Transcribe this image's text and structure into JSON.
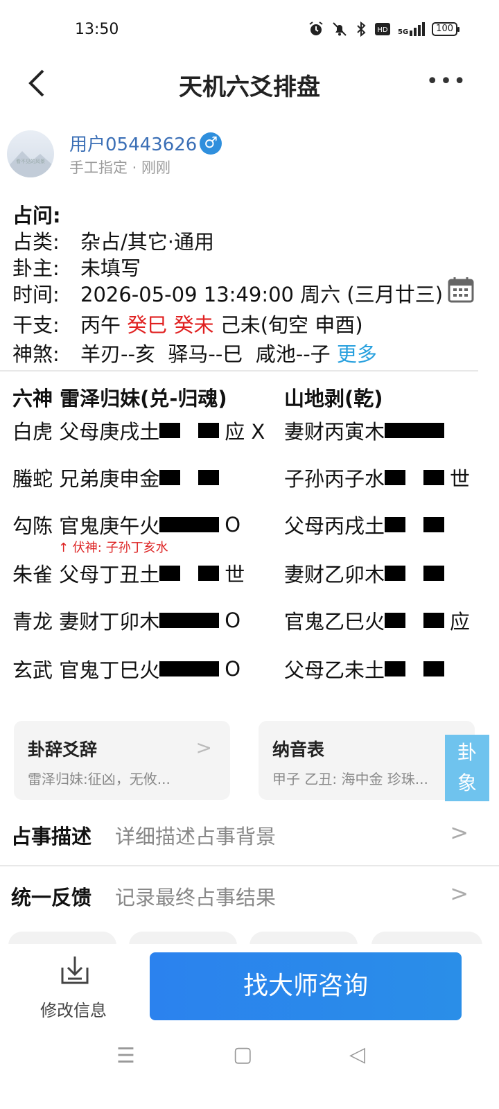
{
  "status": {
    "time": "13:50",
    "network": "5G",
    "battery": "100"
  },
  "header": {
    "title": "天机六爻排盘",
    "more": "•••"
  },
  "user": {
    "name": "用户05443626",
    "gender_icon": "♂",
    "sub": "手工指定 · 刚刚",
    "avatar_caption": "看不见的风景"
  },
  "info": {
    "question_label": "占问:",
    "category_label": "占类:",
    "category_value": "杂占/其它·通用",
    "owner_label": "卦主:",
    "owner_value": "未填写",
    "time_label": "时间:",
    "time_value": "2026-05-09 13:49:00 周六 (三月廿三)",
    "ganzhi_label": "干支:",
    "ganzhi_1": "丙午",
    "ganzhi_2": "癸巳",
    "ganzhi_3": "癸未",
    "ganzhi_4": "己未(旬空 申酉)",
    "shensha_label": "神煞:",
    "shensha_value": "羊刃--亥  驿马--巳  咸池--子",
    "shensha_more": "更多"
  },
  "hexagram": {
    "col1_title": "六神 雷泽归妹(兑-归魂)",
    "col2_title": "山地剥(乾)",
    "left_lines": [
      {
        "text": "白虎 父母庚戌土",
        "type": "yin",
        "mark": "应 X"
      },
      {
        "text": "螣蛇 兄弟庚申金",
        "type": "yin",
        "mark": ""
      },
      {
        "text": "勾陈 官鬼庚午火",
        "type": "yang",
        "mark": "O"
      },
      {
        "text": "朱雀 父母丁丑土",
        "type": "yin",
        "mark": "世"
      },
      {
        "text": "青龙 妻财丁卯木",
        "type": "yang",
        "mark": "O"
      },
      {
        "text": "玄武 官鬼丁巳火",
        "type": "yang",
        "mark": "O"
      }
    ],
    "right_lines": [
      {
        "text": "妻财丙寅木",
        "type": "yang",
        "mark": ""
      },
      {
        "text": "子孙丙子水",
        "type": "yin",
        "mark": "世"
      },
      {
        "text": "父母丙戌土",
        "type": "yin",
        "mark": ""
      },
      {
        "text": "妻财乙卯木",
        "type": "yin",
        "mark": ""
      },
      {
        "text": "官鬼乙巳火",
        "type": "yin",
        "mark": "应"
      },
      {
        "text": "父母乙未土",
        "type": "yin",
        "mark": ""
      }
    ],
    "fushen": "↑ 伏神: 子孙丁亥水"
  },
  "cards": [
    {
      "title": "卦辞爻辞",
      "sub": "雷泽归妹:征凶，无攸..."
    },
    {
      "title": "纳音表",
      "sub": "甲子 乙丑: 海中金 珍珠..."
    }
  ],
  "float_tab": {
    "line1": "卦",
    "line2": "象"
  },
  "rows": [
    {
      "title": "占事描述",
      "desc": "详细描述占事背景"
    },
    {
      "title": "统一反馈",
      "desc": "记录最终占事结果"
    }
  ],
  "bottom": {
    "edit_label": "修改信息",
    "consult_label": "找大师咨询"
  },
  "navbar": {
    "menu": "☰",
    "home": "▢",
    "back": "◁"
  }
}
